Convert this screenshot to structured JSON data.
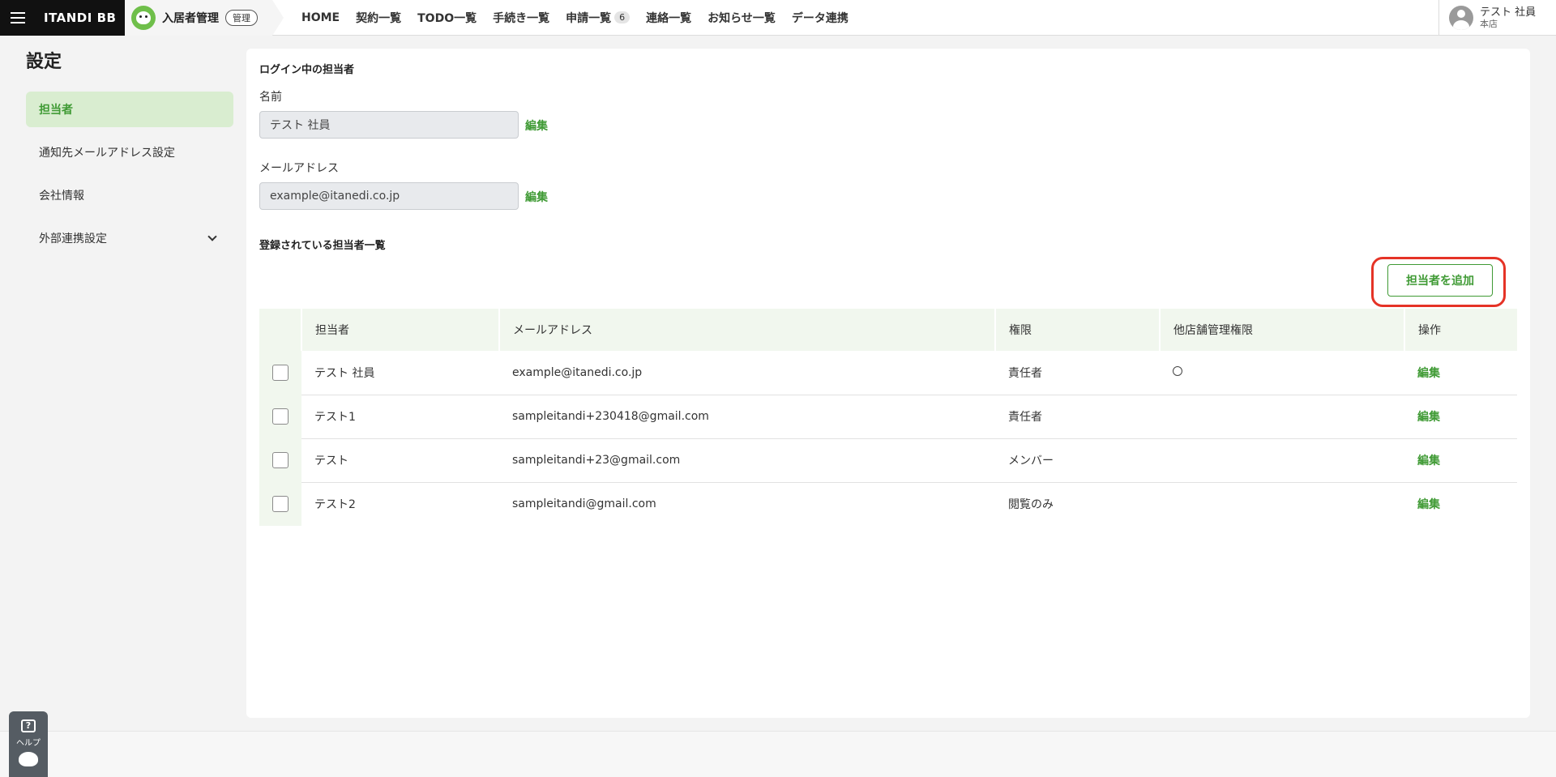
{
  "header": {
    "brand": "ITANDI BB",
    "product": "入居者管理",
    "badge": "管理",
    "nav": [
      {
        "label": "HOME"
      },
      {
        "label": "契約一覧"
      },
      {
        "label": "TODO一覧"
      },
      {
        "label": "手続き一覧"
      },
      {
        "label": "申請一覧",
        "count": "6"
      },
      {
        "label": "連絡一覧"
      },
      {
        "label": "お知らせ一覧"
      },
      {
        "label": "データ連携"
      }
    ],
    "user": {
      "name": "テスト 社員",
      "branch": "本店"
    }
  },
  "page_title": "設定",
  "sidebar": {
    "items": [
      {
        "label": "担当者",
        "active": true
      },
      {
        "label": "通知先メールアドレス設定"
      },
      {
        "label": "会社情報"
      },
      {
        "label": "外部連携設定"
      }
    ]
  },
  "login_user": {
    "section_title": "ログイン中の担当者",
    "name_label": "名前",
    "name_value": "テスト 社員",
    "email_label": "メールアドレス",
    "email_value": "example@itanedi.co.jp",
    "edit_label": "編集"
  },
  "staff_list": {
    "section_title": "登録されている担当者一覧",
    "add_button": "担当者を追加",
    "columns": [
      "担当者",
      "メールアドレス",
      "権限",
      "他店舗管理権限",
      "操作"
    ],
    "rows": [
      {
        "name": "テスト 社員",
        "email": "example@itanedi.co.jp",
        "role": "責任者",
        "other_store": "○",
        "action": "編集"
      },
      {
        "name": "テスト1",
        "email": "sampleitandi+230418@gmail.com",
        "role": "責任者",
        "other_store": "",
        "action": "編集"
      },
      {
        "name": "テスト",
        "email": "sampleitandi+23@gmail.com",
        "role": "メンバー",
        "other_store": "",
        "action": "編集"
      },
      {
        "name": "テスト2",
        "email": "sampleitandi@gmail.com",
        "role": "閲覧のみ",
        "other_store": "",
        "action": "編集"
      }
    ]
  },
  "help": {
    "label": "ヘルプ",
    "icon": "?"
  }
}
